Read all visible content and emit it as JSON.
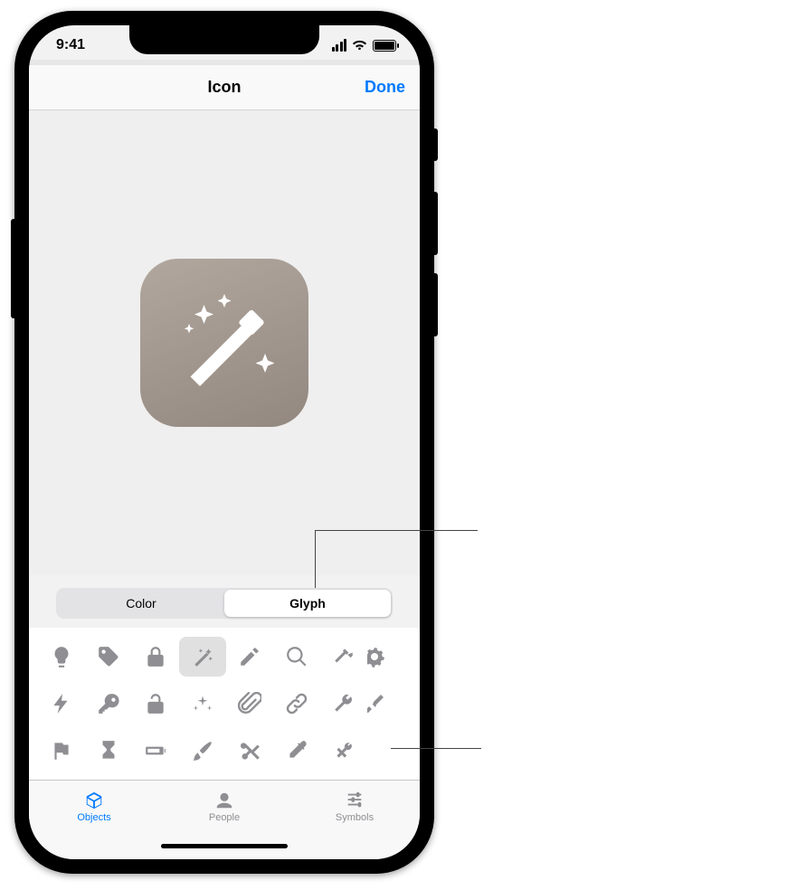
{
  "status": {
    "time": "9:41"
  },
  "nav": {
    "title": "Icon",
    "done": "Done"
  },
  "segmented": {
    "items": [
      "Color",
      "Glyph"
    ],
    "selected": 1
  },
  "glyphs": {
    "selected_row": 0,
    "selected_col": 3,
    "rows": [
      [
        "lightbulb",
        "tag",
        "lock",
        "wand",
        "pencil",
        "magnifier",
        "hammer",
        "gear"
      ],
      [
        "bolt",
        "key",
        "unlock",
        "sparkle",
        "paperclip",
        "link",
        "wrench",
        "screwdriver"
      ],
      [
        "flag",
        "hourglass",
        "battery",
        "paintbrush",
        "scissors",
        "eyedropper",
        "tools",
        ""
      ]
    ]
  },
  "tabs": {
    "items": [
      {
        "label": "Objects",
        "icon": "cube",
        "active": true
      },
      {
        "label": "People",
        "icon": "person",
        "active": false
      },
      {
        "label": "Symbols",
        "icon": "sliders",
        "active": false
      }
    ]
  }
}
